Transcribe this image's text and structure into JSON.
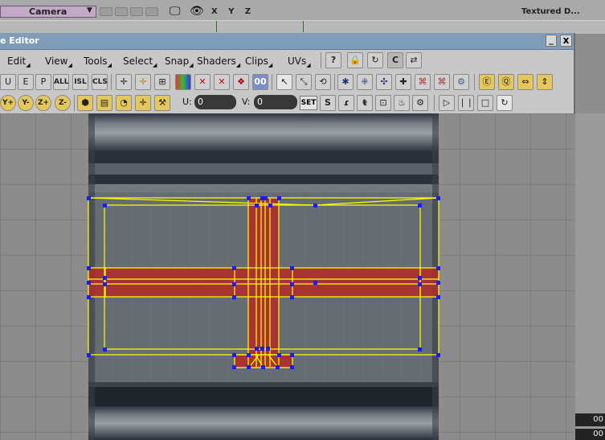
{
  "viewport": {
    "camera_label": "Camera",
    "axes_label": "X Y Z",
    "render_mode": "Textured D..."
  },
  "editor": {
    "title": "e Editor",
    "minimize_label": "_",
    "close_label": "x",
    "menu": [
      "Edit",
      "View",
      "Tools",
      "Select",
      "Snap",
      "Shaders",
      "Clips",
      "UVs"
    ],
    "tool_labels": {
      "all": "ALL",
      "isl": "ISL",
      "cls": "CLS"
    },
    "u_label": "U:",
    "u_value": "0",
    "v_label": "V:",
    "v_value": "0",
    "set_label": "SET",
    "axis_buttons": [
      "Y+",
      "Y-",
      "Z+",
      "Z-"
    ]
  },
  "side_panel": {
    "field1": "00",
    "field2": "00"
  },
  "colors": {
    "wireframe": "#ffff00",
    "vertex": "#1a1aff",
    "selected_face": "#b32a2a",
    "title_bar": "#7f9db9"
  }
}
